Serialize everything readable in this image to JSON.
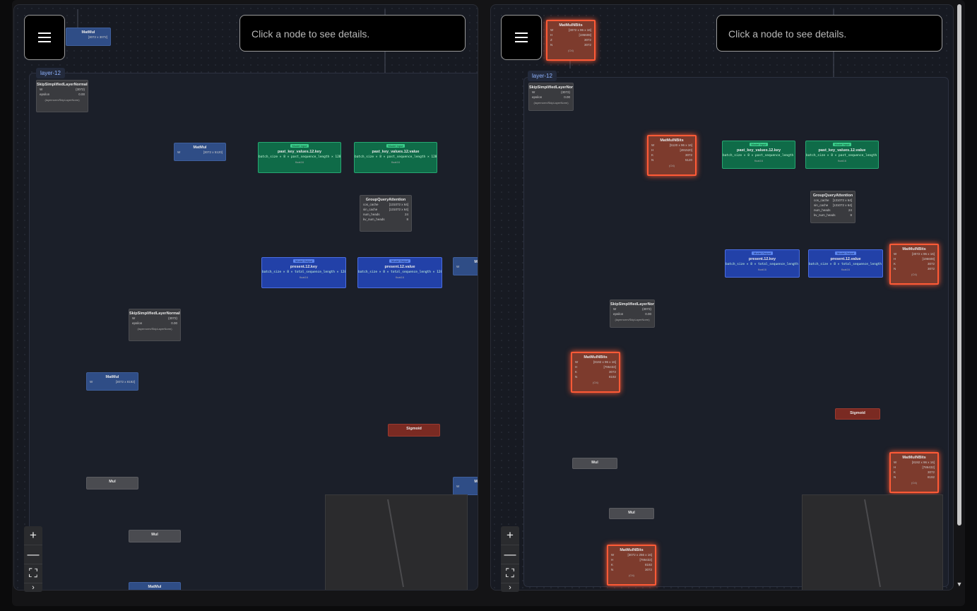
{
  "details_placeholder": "Click a node to see details.",
  "zoom": {
    "plus": "+",
    "minus": "—",
    "fit": "⛶",
    "more": "›"
  },
  "scrollbar": {
    "down_arrow": "▼"
  },
  "left": {
    "group_label": "layer-12",
    "matmul_top": {
      "title": "MatMul",
      "dims": "[3072 x 3072]"
    },
    "skip_norm_1": {
      "title": "SkipSimplifiedLayerNormalization",
      "w_label": "W",
      "w_val": "(3072)",
      "eps_label": "epsilon",
      "eps_val": "0.00",
      "foot": "(layernorm/SkipLayerNorm)"
    },
    "matmul_w": {
      "title": "MatMul",
      "w_label": "W",
      "w_val": "[3072 x 5120]"
    },
    "past_key": {
      "tag": "Model Input",
      "title": "past_key_values.12.key",
      "shape": "batch_size × 8 × past_sequence_length × 128",
      "dtype": "float16"
    },
    "past_value": {
      "tag": "Model Input",
      "title": "past_key_values.12.value",
      "shape": "batch_size × 8 × past_sequence_length × 128",
      "dtype": "float16"
    },
    "gqa": {
      "title": "GroupQueryAttention",
      "cos_label": "cos_cache",
      "cos_val": "[131072 x 64]",
      "sin_label": "sin_cache",
      "sin_val": "[131072 x 64]",
      "heads_label": "num_heads",
      "heads_val": "24",
      "kv_label": "kv_num_heads",
      "kv_val": "8"
    },
    "present_key": {
      "tag": "Model Output",
      "title": "present.12.key",
      "shape": "batch_size × 8 × total_sequence_length × 128",
      "dtype": "float16"
    },
    "present_value": {
      "tag": "Model Output",
      "title": "present.12.value",
      "shape": "batch_size × 8 × total_sequence_length × 128",
      "dtype": "float16"
    },
    "m_edge_1": {
      "title": "M",
      "w": "W"
    },
    "skip_norm_2": {
      "title": "SkipSimplifiedLayerNormalization",
      "w_label": "W",
      "w_val": "(3072)",
      "eps_label": "epsilon",
      "eps_val": "0.00",
      "foot": "(layernorm/SkipLayerNorm)"
    },
    "matmul_mid": {
      "title": "MatMul",
      "w_label": "W",
      "w_val": "[3072 x 8192]"
    },
    "sigmoid": {
      "title": "Sigmoid"
    },
    "mul_1": {
      "title": "Mul"
    },
    "m_edge_2": {
      "title": "M",
      "w": "W"
    },
    "mul_2": {
      "title": "Mul"
    },
    "matmul_bottom": {
      "title": "MatMul"
    }
  },
  "right": {
    "group_label": "layer-12",
    "mmnb_top": {
      "title": "MatMulNBits",
      "w_label": "W",
      "w_val": "[3072 x 96 x 16]",
      "h_label": "H",
      "h_val": "[196608]",
      "z_label": "Z",
      "z_val": "3072",
      "n_label": "N",
      "n_val": "3072",
      "foot": "(O4)"
    },
    "skip_norm_1": {
      "title": "SkipSimplifiedLayerNormalization",
      "w_label": "W",
      "w_val": "(3072)",
      "eps_label": "epsilon",
      "eps_val": "0.00",
      "foot": "(layernorm/SkipLayerNorm)"
    },
    "mmnb_qkv": {
      "title": "MatMulNBits",
      "w_label": "W",
      "w_val": "[5120 x 96 x 16]",
      "h_label": "H",
      "h_val": "[491520]",
      "z_label": "K",
      "z_val": "3072",
      "n_label": "N",
      "n_val": "5120",
      "foot": "(O4)"
    },
    "past_key": {
      "tag": "Model Input",
      "title": "past_key_values.12.key",
      "shape": "batch_size × 8 × past_sequence_length × 128",
      "dtype": "float16"
    },
    "past_value": {
      "tag": "Model Input",
      "title": "past_key_values.12.value",
      "shape": "batch_size × 8 × past_sequence_length × 128",
      "dtype": "float16"
    },
    "gqa": {
      "title": "GroupQueryAttention",
      "cos_label": "cos_cache",
      "cos_val": "[131072 x 64]",
      "sin_label": "sin_cache",
      "sin_val": "[131072 x 64]",
      "heads_label": "num_heads",
      "heads_val": "24",
      "kv_label": "kv_num_heads",
      "kv_val": "8"
    },
    "present_key": {
      "tag": "Model Output",
      "title": "present.12.key",
      "shape": "batch_size × 8 × total_sequence_length × 128",
      "dtype": "float16"
    },
    "present_value": {
      "tag": "Model Output",
      "title": "present.12.value",
      "shape": "batch_size × 8 × total_sequence_length × 128",
      "dtype": "float16"
    },
    "mmnb_o": {
      "title": "MatMulNBits",
      "w_label": "W",
      "w_val": "[3072 x 96 x 16]",
      "h_label": "H",
      "h_val": "[196608]",
      "z_label": "K",
      "z_val": "3072",
      "n_label": "N",
      "n_val": "3072",
      "foot": "(O4)"
    },
    "skip_norm_2": {
      "title": "SkipSimplifiedLayerNormalization",
      "w_label": "W",
      "w_val": "(3072)",
      "eps_label": "epsilon",
      "eps_val": "0.00",
      "foot": "(layernorm/SkipLayerNorm)"
    },
    "mmnb_up": {
      "title": "MatMulNBits",
      "w_label": "W",
      "w_val": "[8192 x 96 x 16]",
      "h_label": "H",
      "h_val": "[786432]",
      "z_label": "K",
      "z_val": "3072",
      "n_label": "N",
      "n_val": "8192",
      "foot": "(O4)"
    },
    "sigmoid": {
      "title": "Sigmoid"
    },
    "mul_1": {
      "title": "Mul"
    },
    "mmnb_gate": {
      "title": "MatMulNBits",
      "w_label": "W",
      "w_val": "[8192 x 96 x 16]",
      "h_label": "H",
      "h_val": "[786432]",
      "z_label": "K",
      "z_val": "3072",
      "n_label": "N",
      "n_val": "8192",
      "foot": "(O4)"
    },
    "mul_2": {
      "title": "Mul"
    },
    "mmnb_down": {
      "title": "MatMulNBits",
      "w_label": "W",
      "w_val": "[3072 x 256 x 16]",
      "h_label": "H",
      "h_val": "[786432]",
      "z_label": "K",
      "z_val": "8192",
      "n_label": "N",
      "n_val": "3072",
      "foot": "(O4)"
    }
  }
}
